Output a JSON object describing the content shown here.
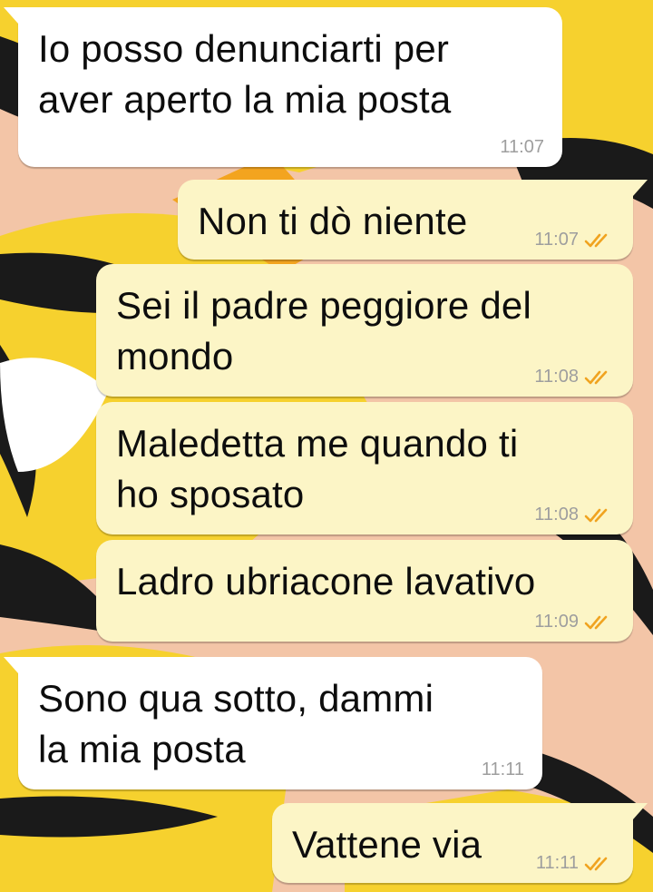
{
  "chat": {
    "messages": [
      {
        "direction": "incoming",
        "text": "Io posso denunciarti per\naver aperto la mia posta",
        "time": "11:07",
        "status": ""
      },
      {
        "direction": "outgoing",
        "text": "Non ti dò niente",
        "time": "11:07",
        "status": "read"
      },
      {
        "direction": "outgoing",
        "text": "Sei il padre peggiore del\nmondo",
        "time": "11:08",
        "status": "read"
      },
      {
        "direction": "outgoing",
        "text": "Maledetta me quando ti\nho sposato",
        "time": "11:08",
        "status": "read"
      },
      {
        "direction": "outgoing",
        "text": "Ladro ubriacone lavativo",
        "time": "11:09",
        "status": "read"
      },
      {
        "direction": "incoming",
        "text": "Sono qua sotto, dammi\nla mia posta",
        "time": "11:11",
        "status": ""
      },
      {
        "direction": "outgoing",
        "text": "Vattene via",
        "time": "11:11",
        "status": "read"
      }
    ]
  },
  "icons": {
    "read_receipt": "double-check-icon"
  },
  "colors": {
    "incoming_bubble": "#ffffff",
    "outgoing_bubble": "#fcf5c6",
    "read_ticks": "#f0a320",
    "timestamp": "#9e9e9e",
    "wallpaper_yellow": "#f6d12e",
    "wallpaper_peach": "#f3c5a7"
  }
}
